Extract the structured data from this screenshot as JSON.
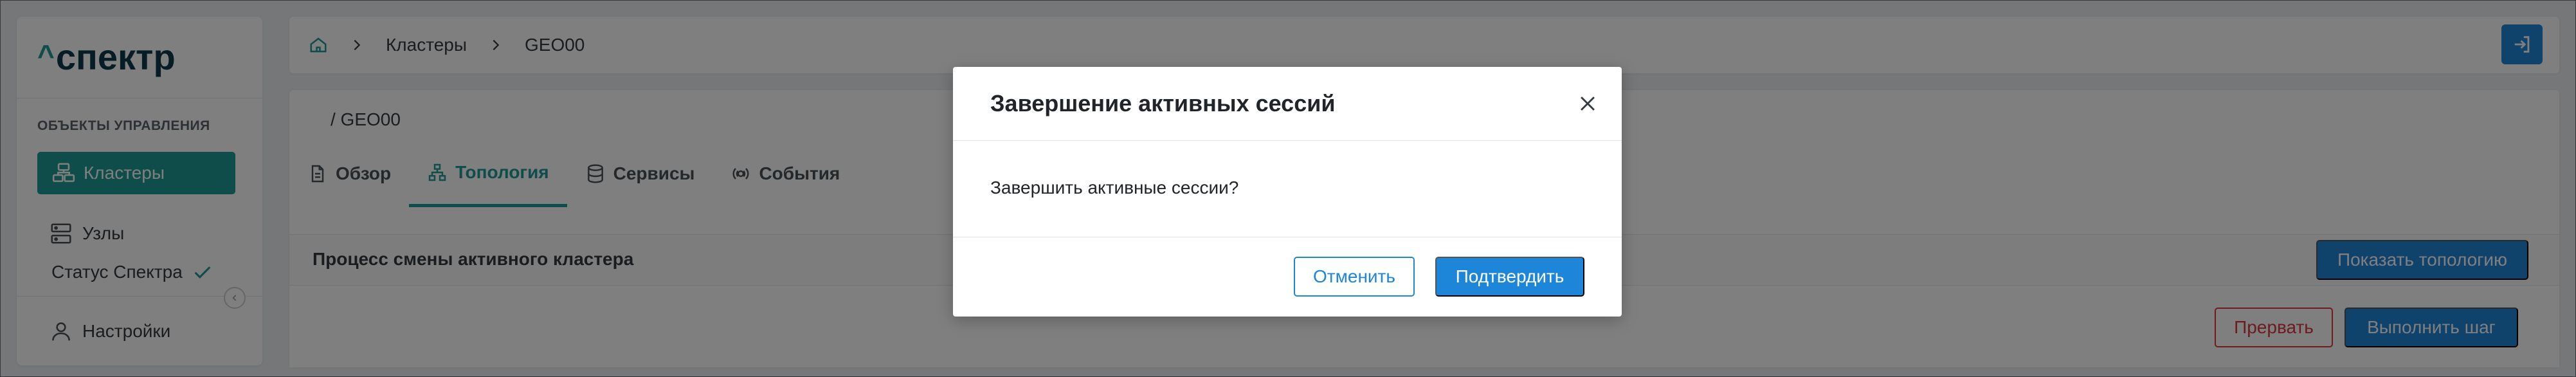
{
  "sidebar": {
    "logo_text": "спектр",
    "logo_caret": "^",
    "section_label": "ОБЪЕКТЫ УПРАВЛЕНИЯ",
    "items": [
      {
        "label": "Кластеры",
        "icon": "clusters-icon",
        "active": true
      },
      {
        "label": "Узлы",
        "icon": "server-icon",
        "active": false
      }
    ],
    "status_label": "Статус Спектра",
    "settings_label": "Настройки"
  },
  "breadcrumbs": {
    "items": [
      "Кластеры",
      "GEO00"
    ]
  },
  "content": {
    "title": "/  GEO00",
    "tabs": [
      {
        "label": "Обзор",
        "icon": "document-icon"
      },
      {
        "label": "Топология",
        "icon": "topology-icon",
        "active": true
      },
      {
        "label": "Сервисы",
        "icon": "database-icon"
      },
      {
        "label": "События",
        "icon": "events-icon"
      }
    ],
    "panel_title": "Процесс смены активного кластера",
    "show_topology_label": "Показать топологию",
    "abort_label": "Прервать",
    "execute_step_label": "Выполнить шаг"
  },
  "modal": {
    "title": "Завершение активных сессий",
    "body": "Завершить активные сессии?",
    "cancel_label": "Отменить",
    "confirm_label": "Подтвердить"
  },
  "colors": {
    "accent": "#1c9a93",
    "primary": "#1e86d8",
    "danger": "#d9363e",
    "logo": "#0d3a4c"
  }
}
